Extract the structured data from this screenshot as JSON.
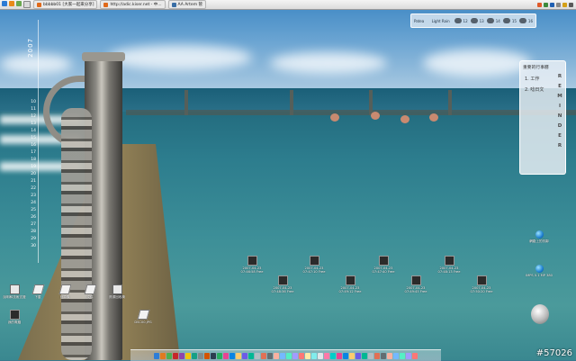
{
  "taskbar": {
    "tasks": [
      {
        "label": "bbbbb01 [大家一起來分享]"
      },
      {
        "label": "http://adic.kiser.net - 中..."
      },
      {
        "label": "AA Artem 管"
      }
    ]
  },
  "calendar": {
    "year": "2007",
    "days": [
      "10",
      "11",
      "12",
      "13",
      "14",
      "15",
      "16",
      "17",
      "18",
      "19",
      "20",
      "21",
      "22",
      "23",
      "24",
      "25",
      "26",
      "27",
      "28",
      "29",
      "30"
    ]
  },
  "weather": {
    "place": "Patea",
    "condition": "Light Rain",
    "days": [
      {
        "label": "12"
      },
      {
        "label": "13"
      },
      {
        "label": "14"
      },
      {
        "label": "15"
      },
      {
        "label": "16"
      }
    ]
  },
  "reminder": {
    "title": "重要的行事曆",
    "items": [
      "1. 工作",
      "2. 唸日文"
    ],
    "letters": [
      "R",
      "E",
      "M",
      "I",
      "N",
      "D",
      "E",
      "R"
    ]
  },
  "desktop_icons": [
    {
      "label": "說明和技術支援"
    },
    {
      "label": "下載"
    },
    {
      "label": "計算機"
    },
    {
      "label": "文件"
    },
    {
      "label": "資源回收筒"
    },
    {
      "label": "我的電腦"
    },
    {
      "label": "DSC00.JPG"
    },
    {
      "label": "2007-04-23 07:46:58 Free"
    },
    {
      "label": "2007-04-23 07:47:10 Free"
    },
    {
      "label": "2007-04-23 07:47:40 Free"
    },
    {
      "label": "2007-04-23 07:48:13 Free"
    },
    {
      "label": "2007-04-23 07:48:36 Free"
    },
    {
      "label": "2007-04-23 07:49:12 Free"
    },
    {
      "label": "2007-04-23 07:49:45 Free"
    },
    {
      "label": "2007-04-23 07:50:20 Free"
    },
    {
      "label": "網路上的芳鄰"
    },
    {
      "label": "IMPS 0.1 MP 380"
    }
  ],
  "watermark": "#57026"
}
